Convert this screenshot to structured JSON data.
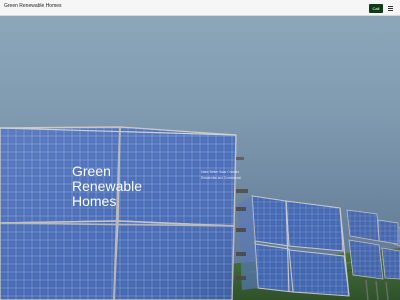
{
  "header": {
    "brand": "Green Renewable Homes",
    "cta_label": "Call",
    "menu_icon": "menu-icon"
  },
  "hero": {
    "title_lines": [
      "Green",
      "Renewable",
      "Homes"
    ],
    "subtitle_lines": [
      "Make Better Solar Choices",
      "Residential and Commercial"
    ],
    "image_icon": "solar-panels-image"
  },
  "colors": {
    "header_bg": "#f6f6f6",
    "cta_bg": "#0b3d16",
    "sky_top": "#87a2b7",
    "sky_bottom": "#5f7795",
    "panel_blue": "#3f64b8",
    "panel_frame": "#b7b7b7",
    "grass": "#3d6f30"
  }
}
